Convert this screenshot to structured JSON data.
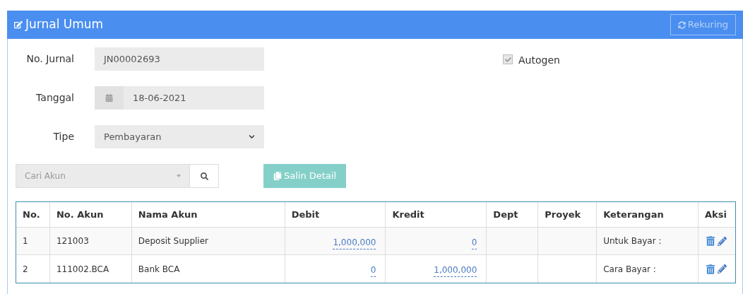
{
  "panel": {
    "title": "Jurnal Umum",
    "action_button": {
      "label": "Rekuring",
      "disabled": true
    }
  },
  "form": {
    "no_jurnal": {
      "label": "No. Jurnal",
      "value": "JN00002693"
    },
    "tanggal": {
      "label": "Tanggal",
      "value": "18-06-2021"
    },
    "tipe": {
      "label": "Tipe",
      "value": "Pembayaran"
    },
    "autogen": {
      "label": "Autogen",
      "checked": true,
      "disabled": true
    }
  },
  "account_search": {
    "placeholder": "Cari Akun"
  },
  "copy_button": {
    "label": "Salin Detail",
    "disabled": true
  },
  "table": {
    "columns": [
      "No.",
      "No. Akun",
      "Nama Akun",
      "Debit",
      "Kredit",
      "Dept",
      "Proyek",
      "Keterangan",
      "Aksi"
    ],
    "rows": [
      {
        "no": "1",
        "no_akun": "121003",
        "nama_akun": "Deposit Supplier",
        "debit": "1,000,000",
        "kredit": "0",
        "dept": "",
        "proyek": "",
        "keterangan": "Untuk Bayar :"
      },
      {
        "no": "2",
        "no_akun": "111002.BCA",
        "nama_akun": "Bank BCA",
        "debit": "0",
        "kredit": "1,000,000",
        "dept": "",
        "proyek": "",
        "keterangan": "Cara Bayar :"
      }
    ]
  }
}
